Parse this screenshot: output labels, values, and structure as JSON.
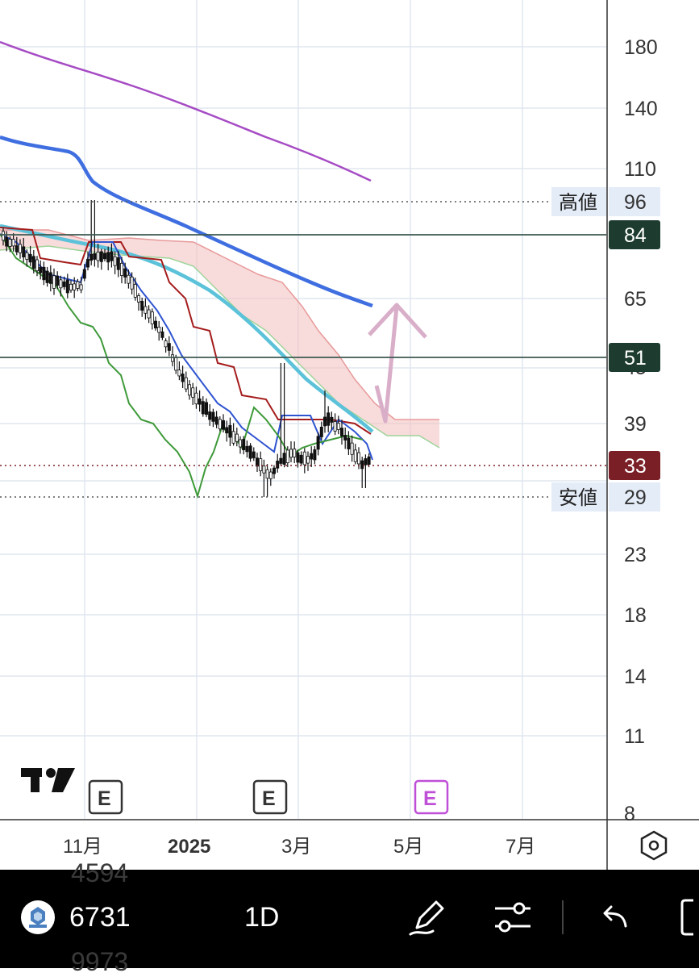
{
  "chart_data": {
    "type": "candlestick",
    "y_scale": "log",
    "y_ticks": [
      180,
      140,
      110,
      65,
      39,
      23,
      18,
      14,
      11,
      8
    ],
    "x_ticks": [
      "11月",
      "2025",
      "3月",
      "5月",
      "7月"
    ],
    "high_label": "高値",
    "high_value": "96",
    "low_label": "安値",
    "low_value": "29",
    "price_levels": [
      {
        "value": "84",
        "color": "#1d3b2f"
      },
      {
        "value": "51",
        "color": "#1d3b2f"
      },
      {
        "value": "33",
        "color": "#7a1f25"
      }
    ],
    "hidden_tick": "45",
    "earnings_markers": [
      "E",
      "E",
      "E"
    ],
    "colors": {
      "ma_long": "#a64bc4",
      "ma_mid": "#3f6ee0",
      "ma_short": "#5bc2d9",
      "tenkan": "#2f54d1",
      "kijun": "#a51c1c",
      "chikou": "#3f9a3a",
      "cloud": "#f3c3c3",
      "arrow": "#d9aec8",
      "earnings_future": "#c04fd8"
    }
  },
  "toolbar": {
    "symbol": "6731",
    "interval": "1D",
    "ghost_text_1": "4594",
    "ghost_text_2": "9973"
  }
}
